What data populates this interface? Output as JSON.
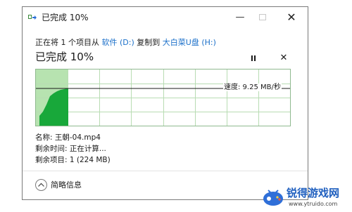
{
  "window": {
    "title": "已完成 10%",
    "controls": {
      "minimize": "—",
      "maximize": "",
      "close": "✕"
    }
  },
  "copy_line": {
    "prefix": "正在将 1 个项目从 ",
    "source": "软件 (D:)",
    "middle": " 复制到 ",
    "destination": "大白菜U盘 (H:)"
  },
  "progress": {
    "title": "已完成 10%",
    "percent": 10,
    "pause_label": "II",
    "cancel_label": "✕"
  },
  "graph": {
    "speed_text": "速度: 9.25 MB/秒",
    "colors": {
      "done_fill": "#b7e3b0",
      "curve_fill": "#18a83a",
      "grid": "#b8dcb3",
      "border": "#8fb98f",
      "speed_line": "#1a1a1a"
    }
  },
  "details": {
    "name": "名称: 王朝-04.mp4",
    "time_remaining": "剩余时间: 正在计算...",
    "items_remaining": "剩余项目: 1 (224 MB)"
  },
  "footer": {
    "toggle_icon": "chevron-up-icon",
    "toggle_label": "简略信息"
  },
  "watermark": {
    "name": "锐得游戏网",
    "url": "www.ytruido.com"
  }
}
